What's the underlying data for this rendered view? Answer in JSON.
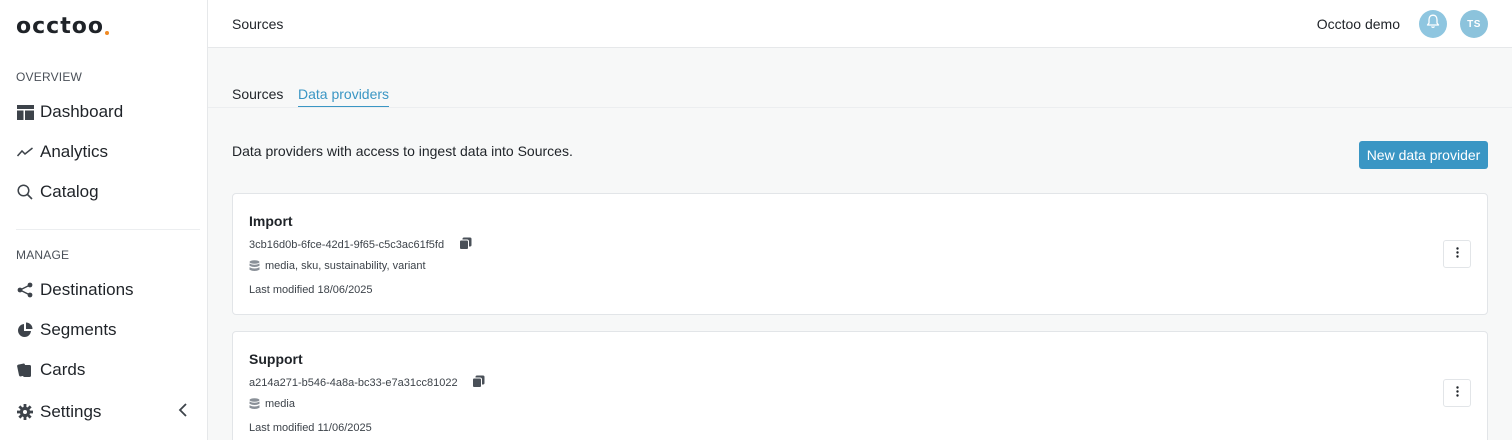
{
  "brand": {
    "logo_text": "occtoo",
    "accent_color": "#f08a24"
  },
  "colors": {
    "primary": "#3a96c4",
    "bell_bg": "#8fc6e0",
    "avatar_bg": "#8cc3dc"
  },
  "sidebar": {
    "overview_label": "OVERVIEW",
    "manage_label": "MANAGE",
    "items": [
      {
        "label": "Dashboard",
        "icon": "dashboard-icon"
      },
      {
        "label": "Analytics",
        "icon": "analytics-icon"
      },
      {
        "label": "Catalog",
        "icon": "search-icon"
      },
      {
        "label": "Destinations",
        "icon": "share-icon"
      },
      {
        "label": "Segments",
        "icon": "pie-chart-icon"
      },
      {
        "label": "Cards",
        "icon": "cards-icon"
      },
      {
        "label": "Settings",
        "icon": "gear-icon"
      }
    ]
  },
  "header": {
    "title": "Sources",
    "org_name": "Occtoo demo",
    "avatar_initials": "TS"
  },
  "tabs": [
    {
      "label": "Sources",
      "active": false
    },
    {
      "label": "Data providers",
      "active": true
    }
  ],
  "main": {
    "description": "Data providers with access to ingest data into Sources.",
    "new_button_label": "New data provider",
    "providers": [
      {
        "name": "Import",
        "id": "3cb16d0b-6fce-42d1-9f65-c5c3ac61f5fd",
        "tags": "media, sku, sustainability, variant",
        "modified": "Last modified 18/06/2025"
      },
      {
        "name": "Support",
        "id": "a214a271-b546-4a8a-bc33-e7a31cc81022",
        "tags": "media",
        "modified": "Last modified 11/06/2025"
      }
    ]
  }
}
